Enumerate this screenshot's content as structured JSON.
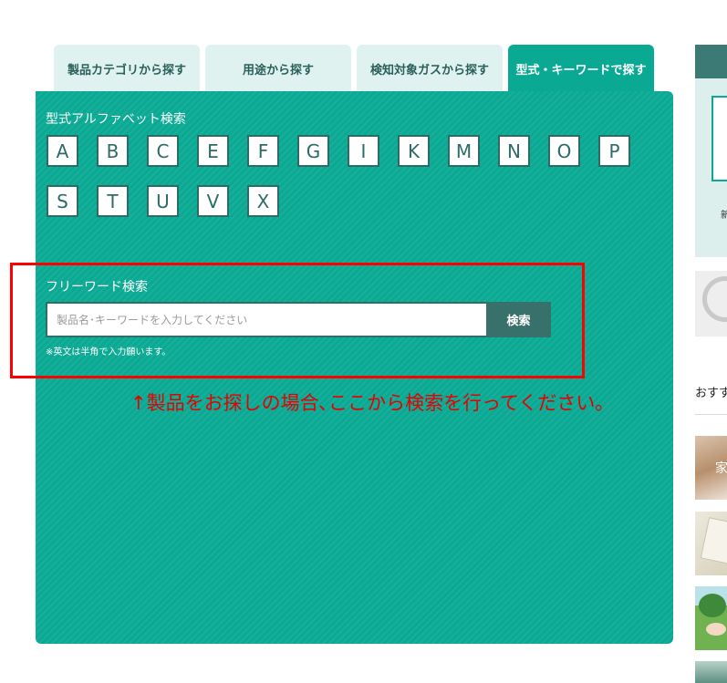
{
  "tabs": [
    {
      "label": "製品カテゴリから探す",
      "active": false
    },
    {
      "label": "用途から探す",
      "active": false
    },
    {
      "label": "検知対象ガスから探す",
      "active": false
    },
    {
      "label": "型式・キーワードで探す",
      "active": true
    }
  ],
  "alphabet_search": {
    "title": "型式アルファベット検索",
    "letters": [
      "A",
      "B",
      "C",
      "E",
      "F",
      "G",
      "I",
      "K",
      "M",
      "N",
      "O",
      "P",
      "S",
      "T",
      "U",
      "V",
      "X"
    ]
  },
  "freeword_search": {
    "title": "フリーワード検索",
    "placeholder": "製品名･キーワードを入力してください",
    "value": "",
    "button_label": "検索",
    "note": "※英文は半角で入力願います。"
  },
  "annotation": {
    "caption": "↑製品をお探しの場合､ここから検索を行ってください｡",
    "color": "#ff0000"
  },
  "sidebar": {
    "top_char": "新",
    "recommend_label": "おすすめ",
    "thumb1_text": "家"
  },
  "colors": {
    "accent": "#0aa993",
    "tab_inactive": "#dff2ef",
    "button": "#38706b"
  }
}
